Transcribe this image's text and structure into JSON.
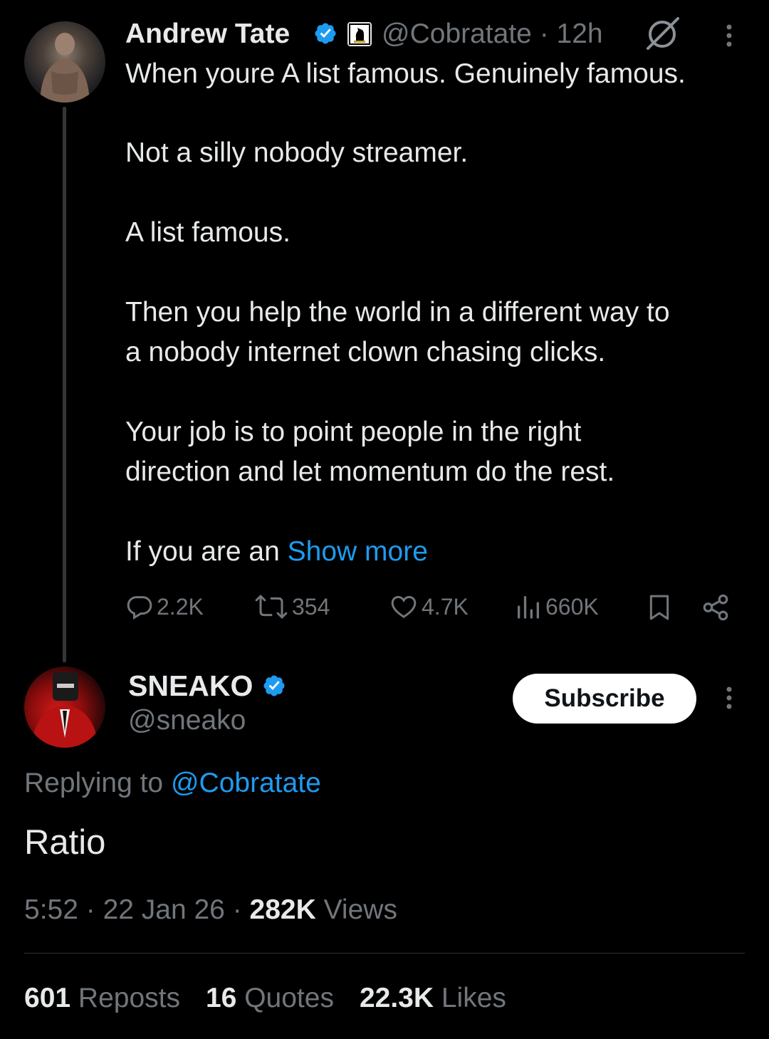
{
  "parent_tweet": {
    "author_name": "Andrew Tate",
    "handle_time": "@Cobratate · 12h",
    "lines": [
      "When youre A list famous. Genuinely famous.",
      "Not a silly nobody streamer.",
      "A list famous.",
      "Then you help the world in a different way to",
      "a nobody internet clown chasing clicks.",
      "Your job is to point people in the right",
      "direction and let momentum do the rest.",
      "If you are an "
    ],
    "show_more": "Show more",
    "actions": {
      "replies": "2.2K",
      "reposts": "354",
      "likes": "4.7K",
      "views": "660K"
    }
  },
  "reply_tweet": {
    "author_name": "SNEAKO",
    "handle": "@sneako",
    "subscribe_label": "Subscribe",
    "replying_prefix": "Replying to ",
    "replying_mention": "@Cobratate",
    "text": "Ratio",
    "time_date": "5:52 · 22 Jan 26 · ",
    "views_count": "282K",
    "views_label": " Views",
    "stats": {
      "reposts_count": "601",
      "reposts_label": " Reposts",
      "quotes_count": "16",
      "quotes_label": " Quotes",
      "likes_count": "22.3K",
      "likes_label": " Likes"
    }
  },
  "colors": {
    "background": "#000000",
    "text": "#e7e9ea",
    "secondary": "#71767b",
    "accent": "#1d9bf0"
  },
  "icons": [
    "verified-badge-icon",
    "affiliate-badge-icon",
    "grok-icon",
    "more-options-icon",
    "reply-icon",
    "repost-icon",
    "like-icon",
    "views-icon",
    "bookmark-icon",
    "share-icon"
  ]
}
